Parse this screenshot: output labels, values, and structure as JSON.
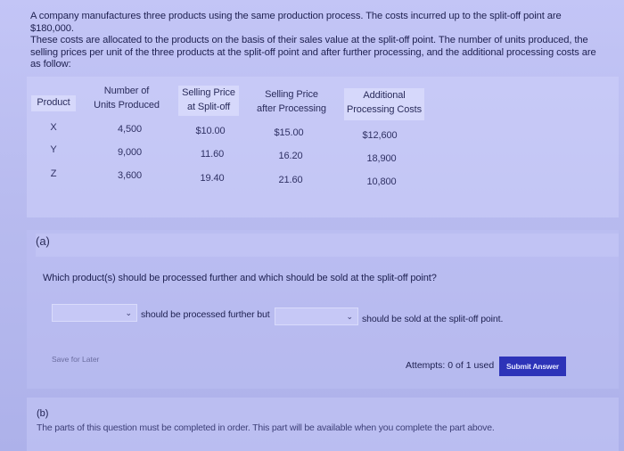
{
  "intro": {
    "line1": "A company manufactures three products using the same production process. The costs incurred up to the split-off point are $180,000.",
    "line2": "These costs are allocated to the products on the basis of their sales value at the split-off point. The number of units produced, the",
    "line3": "selling prices per unit of the three products at the split-off point and after further processing, and the additional processing costs are",
    "line4": "as follow:"
  },
  "table": {
    "headers": {
      "product": "Product",
      "units_1": "Number of",
      "units_2": "Units Produced",
      "split_1": "Selling Price",
      "split_2": "at Split-off",
      "after_1": "Selling Price",
      "after_2": "after Processing",
      "addl_1": "Additional",
      "addl_2": "Processing Costs"
    },
    "rows": [
      {
        "product": "X",
        "units": "4,500",
        "split": "$10.00",
        "after": "$15.00",
        "addl": "$12,600"
      },
      {
        "product": "Y",
        "units": "9,000",
        "split": "11.60",
        "after": "16.20",
        "addl": "18,900"
      },
      {
        "product": "Z",
        "units": "3,600",
        "split": "19.40",
        "after": "21.60",
        "addl": "10,800"
      }
    ]
  },
  "part_a": {
    "label": "(a)",
    "question": "Which product(s) should be processed further and which should be sold at the split-off point?",
    "select1_value": "",
    "text_mid": "should be processed further but",
    "select2_value": "",
    "text_end": "should be sold at the split-off point.",
    "save_label": "Save for Later",
    "attempts": "Attempts: 0 of 1 used",
    "submit_label": "Submit Answer"
  },
  "part_b": {
    "label": "(b)",
    "text": "The parts of this question must be completed in order. This part will be available when you complete the part above."
  },
  "colors": {
    "submit_bg": "#2d33b8",
    "page_bg": "#b9bcf0"
  }
}
